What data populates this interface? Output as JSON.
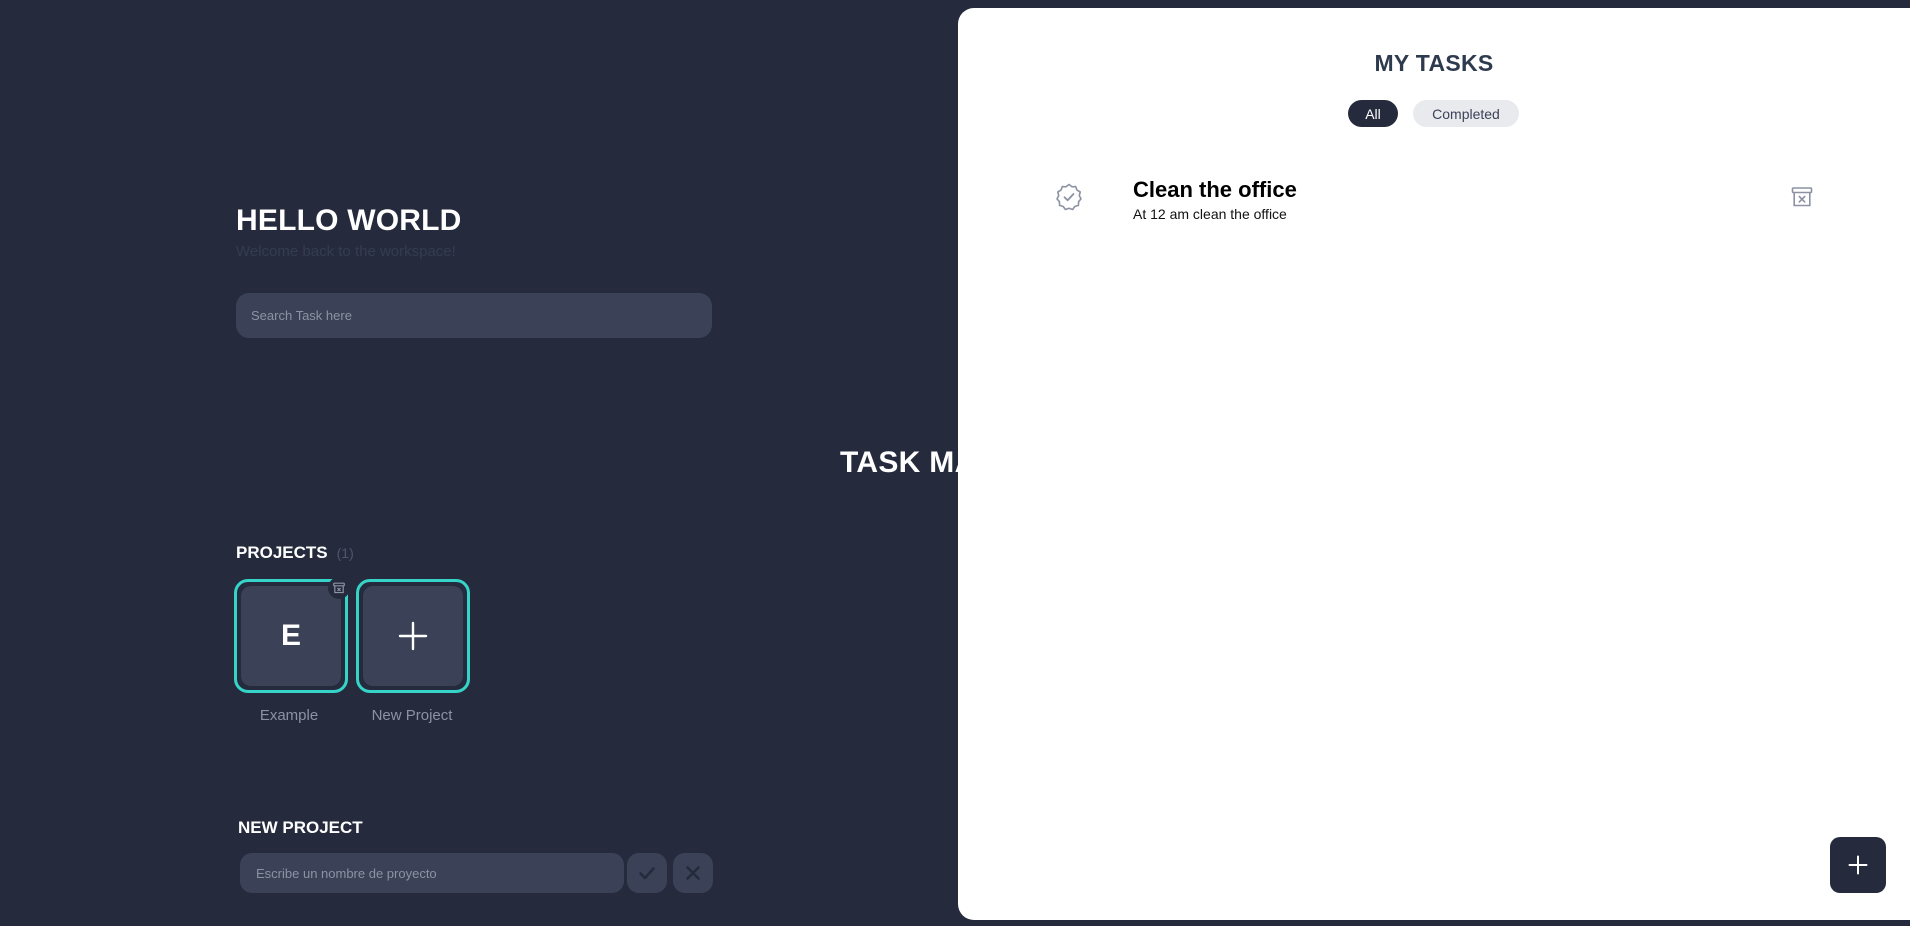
{
  "sidebar": {
    "title": "HELLO WORLD",
    "subtitle": "Welcome back to the workspace!",
    "search_placeholder": "Search Task here",
    "brand": "TASK MANAGER",
    "projects": {
      "label": "PROJECTS",
      "count": "(1)",
      "items": [
        {
          "letter": "E",
          "name": "Example",
          "delete_icon": "archive-x-icon"
        },
        {
          "icon": "plus-icon",
          "name": "New Project"
        }
      ]
    },
    "new_project": {
      "label": "NEW PROJECT",
      "placeholder": "Escribe un nombre de proyecto",
      "confirm_icon": "check-icon",
      "cancel_icon": "close-icon"
    }
  },
  "tasks_panel": {
    "title": "MY TASKS",
    "filters": [
      {
        "label": "All",
        "active": true
      },
      {
        "label": "Completed",
        "active": false
      }
    ],
    "tasks": [
      {
        "title": "Clean the office",
        "description": "At 12 am clean the office",
        "status_icon": "check-badge-icon",
        "delete_icon": "archive-x-icon"
      }
    ],
    "add_button_icon": "plus-icon"
  },
  "colors": {
    "background": "#252b3d",
    "surface": "#3b4257",
    "accent": "#36d4c8",
    "panel": "#ffffff",
    "text_primary": "#ffffff",
    "text_muted": "#8c92a4"
  }
}
